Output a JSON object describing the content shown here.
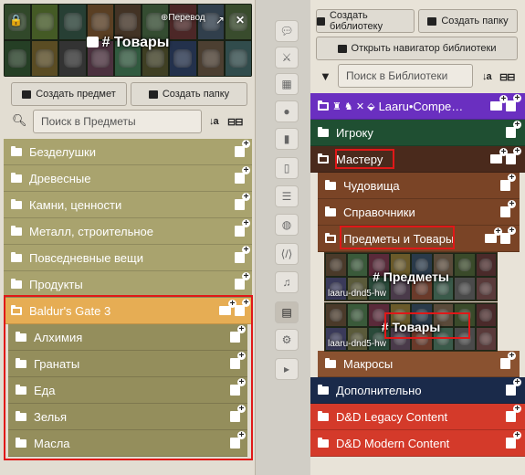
{
  "left": {
    "banner": {
      "title": "# Товары",
      "translate": "Перевод",
      "tile_colors": [
        "#3a5532",
        "#506a2c",
        "#2e4a3e",
        "#6a4a2a",
        "#4f3c2c",
        "#3e5a3a",
        "#5a2e2e",
        "#3a4a5a",
        "#445a36",
        "#2c4a2c",
        "#6a5a2a",
        "#3c3c3c",
        "#5a3a4a",
        "#3a6a4a",
        "#4a4a2a",
        "#2a3a5a",
        "#5a4a3a",
        "#3a5a5a"
      ]
    },
    "buttons": {
      "create_item": "Создать предмет",
      "create_folder": "Создать папку"
    },
    "search": {
      "placeholder": "Поиск в Предметы",
      "sort": "↓a",
      "expand": "⊟⊟"
    },
    "folders": [
      {
        "label": "Безделушки"
      },
      {
        "label": "Древесные"
      },
      {
        "label": "Камни, ценности"
      },
      {
        "label": "Металл, строительное"
      },
      {
        "label": "Повседневные вещи"
      },
      {
        "label": "Продукты"
      },
      {
        "label": "Baldur's Gate 3"
      },
      {
        "label": "Алхимия"
      },
      {
        "label": "Гранаты"
      },
      {
        "label": "Еда"
      },
      {
        "label": "Зелья"
      },
      {
        "label": "Масла"
      }
    ],
    "colors": {
      "folder": "#a9a36e",
      "open": "#e6ad54",
      "child": "#948e5c"
    }
  },
  "mid": {
    "icons": [
      "chat-icon",
      "combat-icon",
      "map-icon",
      "user-icon",
      "items-icon",
      "journal-icon",
      "table-icon",
      "cards-icon",
      "macro-icon",
      "music-icon",
      "compendium-icon",
      "settings-icon",
      "collapse-icon"
    ]
  },
  "right": {
    "buttons": {
      "create_library": "Создать библиотеку",
      "create_folder": "Создать папку",
      "open_navigator": "Открыть навигатор библиотеки"
    },
    "search": {
      "placeholder": "Поиск в Библиотеки",
      "sort": "↓a",
      "expand": "⊟⊟"
    },
    "rows": [
      {
        "label": "Laaru•Compe…",
        "color": "#6a2fc0"
      },
      {
        "label": "Игроку",
        "color": "#1f4f32"
      },
      {
        "label": "Мастеру",
        "color": "#4a2a1c"
      },
      {
        "label": "Чудовища",
        "color": "#7a4426"
      },
      {
        "label": "Справочники",
        "color": "#7a4426"
      },
      {
        "label": "Предметы и Товары",
        "color": "#7a4426"
      },
      {
        "label": "Макросы",
        "color": "#8a5230"
      },
      {
        "label": "Дополнительно",
        "color": "#1a2a4a"
      },
      {
        "label": "D&D Legacy Content",
        "color": "#d43a2a"
      },
      {
        "label": "D&D Modern Content",
        "color": "#d43a2a"
      }
    ],
    "cards": [
      {
        "title": "# Предметы",
        "user": "laaru-dnd5-hw"
      },
      {
        "title": "# Товары",
        "user": "laaru-dnd5-hw"
      }
    ],
    "tile_colors": [
      "#4a3a2a",
      "#3a5a3a",
      "#5a2a3a",
      "#6a5a2a",
      "#2a3a4a",
      "#5a4a3a",
      "#3a4a2a",
      "#4a2a2a",
      "#3a3a5a",
      "#5a5a3a",
      "#2a4a3a",
      "#4a3a4a",
      "#6a3a2a",
      "#3a5a4a",
      "#4a4a4a",
      "#5a3a3a"
    ]
  }
}
